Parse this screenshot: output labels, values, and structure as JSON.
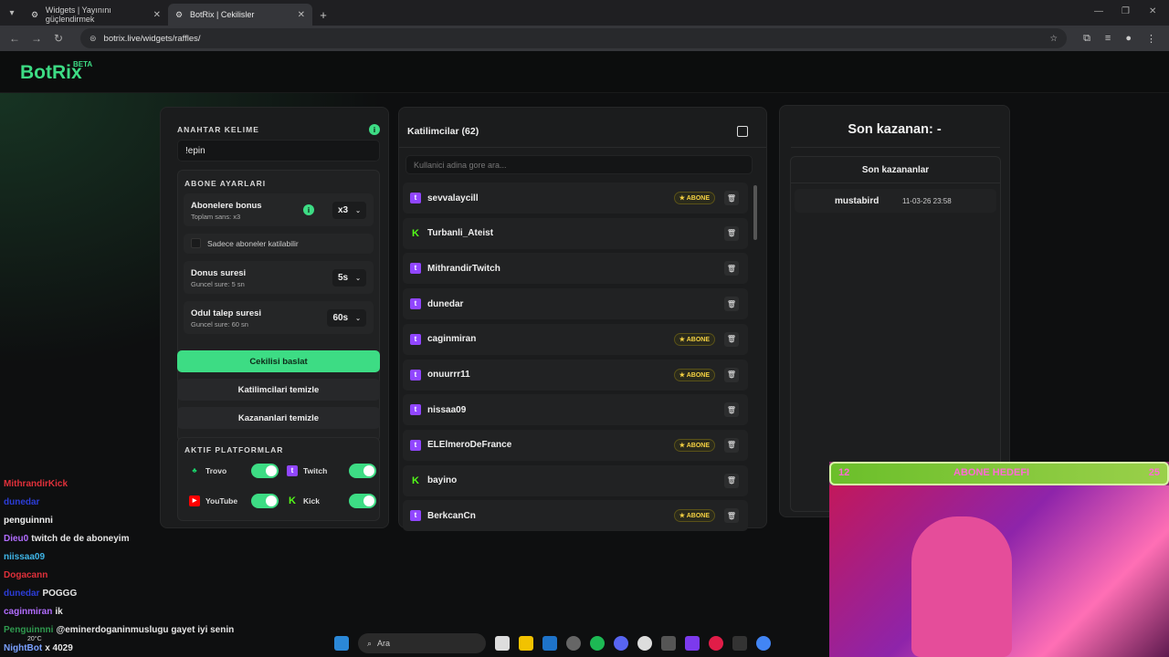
{
  "browser": {
    "tabs": [
      {
        "title": "Widgets | Yayınını güçlendirmek",
        "active": false
      },
      {
        "title": "BotRix | Cekilisler",
        "active": true
      }
    ],
    "new_tab": "+",
    "url": "botrix.live/widgets/raffles/"
  },
  "app": {
    "logo": "BotRix",
    "logo_badge": "BETA"
  },
  "settings": {
    "keyword_title": "ANAHTAR KELIME",
    "keyword_value": "!epin",
    "sub_title": "ABONE AYARLARI",
    "sub_bonus": {
      "label": "Abonelere bonus",
      "sub": "Toplam sans: x3",
      "value": "x3"
    },
    "sub_only": "Sadece aboneler katilabilir",
    "duration": {
      "label": "Donus suresi",
      "sub": "Guncel sure: 5 sn",
      "value": "5s"
    },
    "claim": {
      "label": "Odul talep suresi",
      "sub": "Guncel sure: 60 sn",
      "value": "60s"
    },
    "start_button": "Cekilisi baslat",
    "clear_participants": "Katilimcilari temizle",
    "clear_winners": "Kazananlari temizle",
    "platforms_title": "AKTIF PLATFORMLAR",
    "platforms": [
      {
        "name": "Trovo",
        "enabled": true
      },
      {
        "name": "Twitch",
        "enabled": true
      },
      {
        "name": "YouTube",
        "enabled": true
      },
      {
        "name": "Kick",
        "enabled": true
      }
    ]
  },
  "participants": {
    "title": "Katilimcilar (62)",
    "search_placeholder": "Kullanici adina gore ara...",
    "badge_label": "ABONE",
    "list": [
      {
        "name": "sevvalaycill",
        "platform": "twitch",
        "sub": true
      },
      {
        "name": "Turbanli_Ateist",
        "platform": "kick",
        "sub": false
      },
      {
        "name": "MithrandirTwitch",
        "platform": "twitch",
        "sub": false
      },
      {
        "name": "dunedar",
        "platform": "twitch",
        "sub": false
      },
      {
        "name": "caginmiran",
        "platform": "twitch",
        "sub": true
      },
      {
        "name": "onuurrr11",
        "platform": "twitch",
        "sub": true
      },
      {
        "name": "nissaa09",
        "platform": "twitch",
        "sub": false
      },
      {
        "name": "ELElmeroDeFrance",
        "platform": "twitch",
        "sub": true
      },
      {
        "name": "bayino",
        "platform": "kick",
        "sub": false
      },
      {
        "name": "BerkcanCn",
        "platform": "twitch",
        "sub": true
      }
    ]
  },
  "winners": {
    "last_winner": "Son kazanan: -",
    "list_title": "Son kazananlar",
    "list": [
      {
        "name": "mustabird",
        "date": "11-03-26 23:58"
      }
    ]
  },
  "overlay": {
    "goal_label": "ABONE HEDEFI",
    "goal_current": "12",
    "goal_target": "25",
    "chat": [
      {
        "user": "MithrandirKick",
        "msg": ""
      },
      {
        "user": "dunedar",
        "msg": ""
      },
      {
        "user": "penguinnni",
        "msg": ""
      },
      {
        "user": "Dieu0",
        "msg": "twitch de de aboneyim"
      },
      {
        "user": "niissaa09",
        "msg": ""
      },
      {
        "user": "Dogacann",
        "msg": ""
      },
      {
        "user": "dunedar",
        "msg": "POGGG"
      },
      {
        "user": "caginmiran",
        "msg": "ik"
      },
      {
        "user": "Penguinnni",
        "msg": "@eminerdoganinmuslugu gayet iyi senin"
      },
      {
        "user": "NightBot",
        "msg": "x 4029"
      }
    ],
    "taskbar_search": "Ara",
    "weather": "20°C"
  }
}
